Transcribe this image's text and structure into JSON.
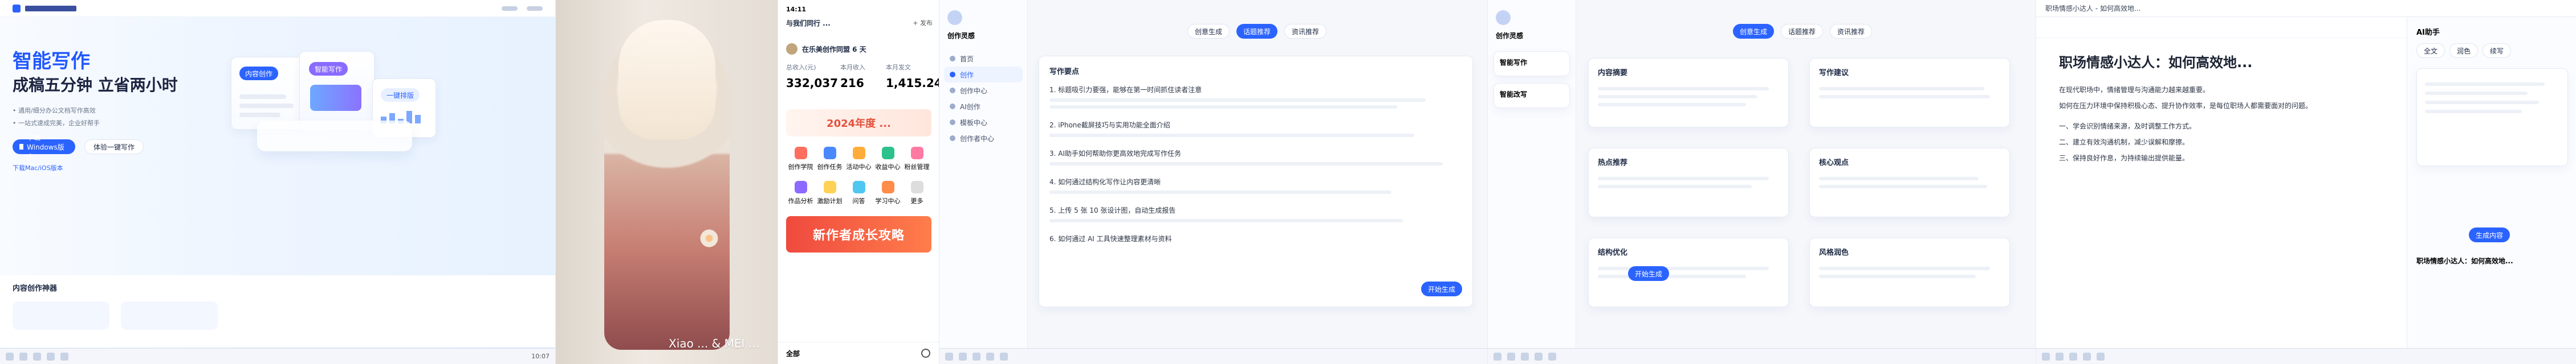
{
  "screen1": {
    "title": "智能写作",
    "headline": "成稿五分钟 立省两小时",
    "bullets": [
      "• 通用/细分办公文档写作高效",
      "• 一站式速成完美，企业好帮手"
    ],
    "primary_button": "下载Windows版本",
    "secondary_button": "体验一键写作",
    "tip": "下载Mac/iOS版本",
    "card_labels": [
      "内容创作",
      "智能写作",
      "一键排版"
    ],
    "bottom_title": "内容创作神器",
    "taskbar_time": "10:07"
  },
  "screen2": {
    "watermark": "Xiao ... & MEI ..."
  },
  "screen3": {
    "status_time": "14:11",
    "header": "与我们同行 ...",
    "name": "在乐美创作同盟 6 天",
    "stats_labels": [
      "总收入(元)",
      "本月收入",
      "本月发文"
    ],
    "stats_values": [
      "332,037",
      "216",
      "1,415.24"
    ],
    "grid_labels": [
      "创作学院",
      "创作任务",
      "活动中心",
      "收益中心",
      "粉丝管理",
      "作品分析",
      "激励计划",
      "问答",
      "学习中心",
      "更多"
    ],
    "banner_title": "新作者成长攻略",
    "promo_title": "2024年度 ...",
    "bottom_left": "全部"
  },
  "screen4": {
    "tabs": [
      "创意生成",
      "话题推荐",
      "资讯推荐"
    ],
    "sidebar_title": "创作灵感",
    "sidebar_items": [
      "首页",
      "创作",
      "创作中心",
      "AI创作",
      "模板中心",
      "创作者中心"
    ],
    "section_title": "写作要点",
    "articles": [
      "1. 标题吸引力要强，能够在第一时间抓住读者注意",
      "2. iPhone截屏技巧与实用功能全面介绍",
      "3. AI助手如何帮助你更高效地完成写作任务",
      "4. 如何通过结构化写作让内容更清晰",
      "5. 上传 5 张 10 张设计图，自动生成报告",
      "6. 如何通过 AI 工具快速整理素材与资料"
    ],
    "action_button": "开始生成"
  },
  "screen5": {
    "tabs": [
      "创意生成",
      "话题推荐",
      "资讯推荐"
    ],
    "sidebar_title": "创作灵感",
    "tools": [
      "智能写作",
      "智能改写"
    ],
    "cards": [
      "内容摘要",
      "写作建议",
      "热点推荐",
      "核心观点",
      "结构优化",
      "风格润色"
    ],
    "bottom_button": "开始生成"
  },
  "screen6": {
    "window_title": "职场情感小达人 - 如何高效地...",
    "article_title": "职场情感小达人：如何高效地...",
    "paragraphs": [
      "在现代职场中，情绪管理与沟通能力越来越重要。",
      "如何在压力环境中保持积极心态、提升协作效率，是每位职场人都需要面对的问题。",
      "一、学会识别情绪来源，及时调整工作方式。",
      "二、建立有效沟通机制，减少误解和摩擦。",
      "三、保持良好作息，为持续输出提供能量。"
    ],
    "sidebar_title": "AI助手",
    "panel_tabs": [
      "全文",
      "润色",
      "续写"
    ],
    "prompt_title": "职场情感小达人：如何高效地...",
    "panel_button": "生成内容"
  }
}
